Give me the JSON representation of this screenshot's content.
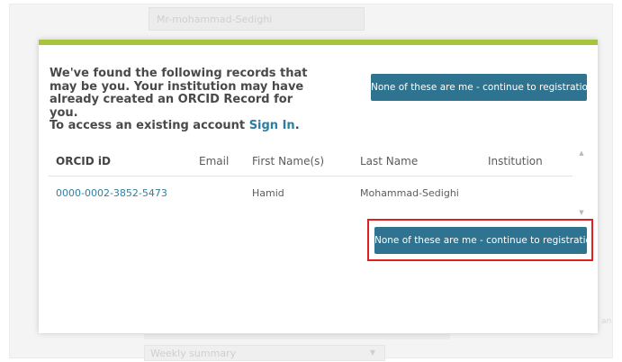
{
  "background": {
    "name_field_value": "Mr-mohammad-Sedighi",
    "notification_select_value": "Weekly summary",
    "right_edge_text": "an"
  },
  "modal": {
    "message": {
      "line1": "We've found the following records that",
      "line2": "may be you. Your institution may have",
      "line3": "already created an ORCID Record for you.",
      "line4_prefix": "To access an existing account ",
      "sign_in_link": "Sign In",
      "line4_suffix": "."
    },
    "none_button_top": "None of these are me - continue to registration",
    "none_button_bottom": "None of these are me - continue to registration",
    "table": {
      "headers": {
        "orcid": "ORCID iD",
        "email": "Email",
        "first_name": "First Name(s)",
        "last_name": "Last Name",
        "institution": "Institution"
      },
      "rows": [
        {
          "orcid": "0000-0002-3852-5473",
          "email": "",
          "first_name": "Hamid",
          "last_name": "Mohammad-Sedighi",
          "institution": ""
        }
      ]
    }
  },
  "colors": {
    "accent_bar": "#a6c43c",
    "button": "#2e7390",
    "link": "#2e7f9f",
    "highlight": "#e01f1f"
  }
}
